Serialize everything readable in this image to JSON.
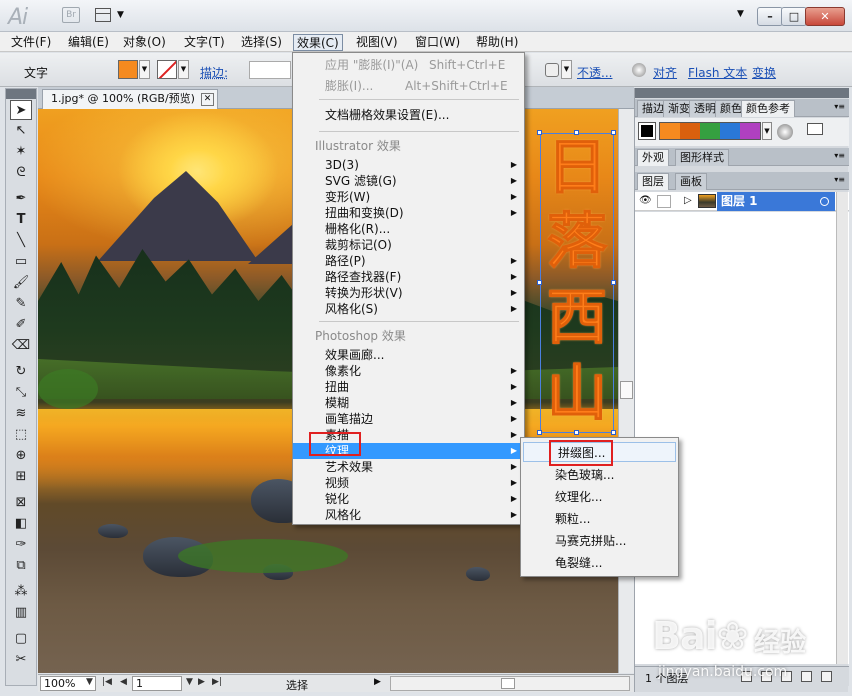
{
  "app": {
    "logo": "Ai",
    "bridge": "Br"
  },
  "menubar": {
    "items": [
      {
        "label": "文件(F)"
      },
      {
        "label": "编辑(E)"
      },
      {
        "label": "对象(O)"
      },
      {
        "label": "文字(T)"
      },
      {
        "label": "选择(S)"
      },
      {
        "label": "效果(C)"
      },
      {
        "label": "视图(V)"
      },
      {
        "label": "窗口(W)"
      },
      {
        "label": "帮助(H)"
      }
    ]
  },
  "controlbar": {
    "label": "文字",
    "stroke_label": "描边:",
    "opacity_link": "不透...",
    "align_link": "对齐",
    "flash_link": "Flash 文本",
    "transform_link": "变换",
    "fill_color": "#f58a1f"
  },
  "document": {
    "tab_title": "1.jpg* @ 100% (RGB/预览)",
    "close": "✕"
  },
  "canvas_text": {
    "chars": [
      "日",
      "落",
      "西",
      "山"
    ],
    "color": "#ff7e1a"
  },
  "effect_menu": {
    "apply_last": {
      "label": "应用 \"膨胀(I)\"(A)",
      "shortcut": "Shift+Ctrl+E"
    },
    "last_effect": {
      "label": "膨胀(I)...",
      "shortcut": "Alt+Shift+Ctrl+E"
    },
    "raster_settings": "文档栅格效果设置(E)...",
    "illustrator_header": "Illustrator 效果",
    "illustrator_items": [
      {
        "label": "3D(3)",
        "sub": true
      },
      {
        "label": "SVG 滤镜(G)",
        "sub": true
      },
      {
        "label": "变形(W)",
        "sub": true
      },
      {
        "label": "扭曲和变换(D)",
        "sub": true
      },
      {
        "label": "栅格化(R)...",
        "sub": false
      },
      {
        "label": "裁剪标记(O)",
        "sub": false
      },
      {
        "label": "路径(P)",
        "sub": true
      },
      {
        "label": "路径查找器(F)",
        "sub": true
      },
      {
        "label": "转换为形状(V)",
        "sub": true
      },
      {
        "label": "风格化(S)",
        "sub": true
      }
    ],
    "photoshop_header": "Photoshop 效果",
    "photoshop_items": [
      {
        "label": "效果画廊...",
        "sub": false
      },
      {
        "label": "像素化",
        "sub": true
      },
      {
        "label": "扭曲",
        "sub": true
      },
      {
        "label": "模糊",
        "sub": true
      },
      {
        "label": "画笔描边",
        "sub": true
      },
      {
        "label": "素描",
        "sub": true
      },
      {
        "label": "纹理",
        "sub": true
      },
      {
        "label": "艺术效果",
        "sub": true
      },
      {
        "label": "视频",
        "sub": true
      },
      {
        "label": "锐化",
        "sub": true
      },
      {
        "label": "风格化",
        "sub": true
      }
    ],
    "highlighted": "纹理"
  },
  "texture_submenu": {
    "items": [
      "拼缀图...",
      "染色玻璃...",
      "纹理化...",
      "颗粒...",
      "马赛克拼贴...",
      "龟裂缝..."
    ],
    "hovered": "拼缀图..."
  },
  "panels": {
    "top_tabs": [
      "描边",
      "渐变",
      "透明",
      "颜色",
      "颜色参考"
    ],
    "guide_colors": [
      "#f58a1f",
      "#d9600e",
      "#35a040",
      "#2a78d8",
      "#b040c0"
    ],
    "appearance_tabs": [
      "外观",
      "图形样式"
    ],
    "layers_tabs": [
      "图层",
      "画板"
    ],
    "layer_name": "图层 1",
    "layers_count": "1 个图层"
  },
  "statusbar": {
    "zoom": "100%",
    "page": "1",
    "mode": "选择"
  },
  "watermark": {
    "logo": "Bai❀",
    "text": "经验",
    "url": "jingyan.baidu.com"
  }
}
